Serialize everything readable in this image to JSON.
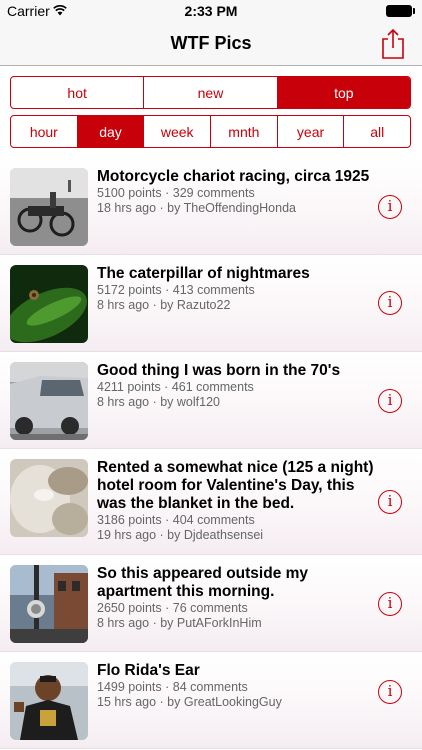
{
  "status_bar": {
    "carrier": "Carrier",
    "time": "2:33 PM"
  },
  "nav": {
    "title": "WTF Pics",
    "share_icon": "share-icon"
  },
  "sort_tabs": [
    {
      "label": "hot",
      "active": false
    },
    {
      "label": "new",
      "active": false
    },
    {
      "label": "top",
      "active": true
    }
  ],
  "time_tabs": [
    {
      "label": "hour",
      "active": false
    },
    {
      "label": "day",
      "active": true
    },
    {
      "label": "week",
      "active": false
    },
    {
      "label": "mnth",
      "active": false
    },
    {
      "label": "year",
      "active": false
    },
    {
      "label": "all",
      "active": false
    }
  ],
  "colors": {
    "accent": "#c8000a",
    "meta_text": "#666666"
  },
  "posts": [
    {
      "title": "Motorcycle chariot racing, circa 1925",
      "stats": "5100 points · 329 comments",
      "byline": "18 hrs ago · by TheOffendingHonda"
    },
    {
      "title": "The caterpillar of nightmares",
      "stats": "5172 points · 413 comments",
      "byline": "8 hrs ago · by Razuto22"
    },
    {
      "title": "Good thing I was born in the 70's",
      "stats": "4211 points · 461 comments",
      "byline": "8 hrs ago · by wolf120"
    },
    {
      "title": "Rented a somewhat nice (125 a night) hotel room for Valentine's Day, this was the blanket in the bed.",
      "stats": "3186 points · 404 comments",
      "byline": "19 hrs ago · by Djdeathsensei"
    },
    {
      "title": "So this appeared outside my apartment this morning.",
      "stats": "2650 points · 76 comments",
      "byline": "8 hrs ago · by PutAForkInHim"
    },
    {
      "title": "Flo Rida's Ear",
      "stats": "1499 points · 84 comments",
      "byline": "15 hrs ago · by GreatLookingGuy"
    }
  ]
}
